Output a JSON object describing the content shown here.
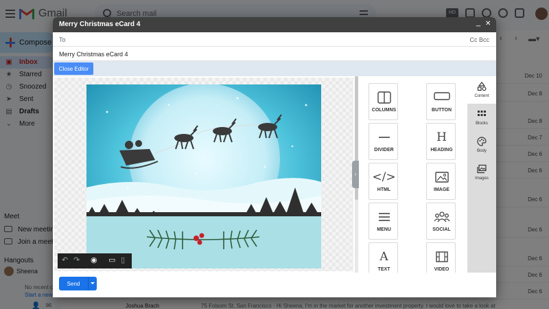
{
  "gmail": {
    "app_name": "Gmail",
    "search_placeholder": "Search mail",
    "compose_label": "Compose",
    "nav": [
      {
        "label": "Inbox",
        "icon": "inbox-icon",
        "active": true
      },
      {
        "label": "Starred",
        "icon": "star-icon"
      },
      {
        "label": "Snoozed",
        "icon": "clock-icon"
      },
      {
        "label": "Sent",
        "icon": "send-icon"
      },
      {
        "label": "Drafts",
        "icon": "draft-icon",
        "bold": true
      },
      {
        "label": "More",
        "icon": "chevron-down-icon"
      }
    ],
    "meet_label": "Meet",
    "meet_items": [
      "New meeting",
      "Join a meeting"
    ],
    "hangouts_label": "Hangouts",
    "hangouts_user": "Sheena",
    "no_recent": "No recent ch",
    "start_new": "Start a new",
    "list_dates": [
      "Dec 10",
      "Dec 8",
      "Dec 8",
      "Dec 7",
      "Dec 6",
      "Dec 6",
      "Dec 6",
      "Dec 6",
      "Dec 6",
      "Dec 6",
      "Dec 6",
      "Dec 6",
      "Dec 6"
    ],
    "last_row": {
      "sender": "Joshua Brach",
      "snippet": "75 Folsom St, San Francisco - Hi Sheena, I'm in the market for another investment property. I would love to take a look at"
    }
  },
  "dialog": {
    "title": "Merry Christmas eCard 4",
    "to_label": "To",
    "cc_bcc": "Cc Bcc",
    "subject": "Merry Christmas eCard 4",
    "close_editor": "Close Editor",
    "send_label": "Send"
  },
  "tools": [
    {
      "label": "COLUMNS",
      "icon": "columns-icon"
    },
    {
      "label": "BUTTON",
      "icon": "button-icon"
    },
    {
      "label": "DIVIDER",
      "icon": "divider-icon"
    },
    {
      "label": "HEADING",
      "icon": "heading-icon",
      "glyph": "H"
    },
    {
      "label": "HTML",
      "icon": "code-icon",
      "glyph": "</>"
    },
    {
      "label": "IMAGE",
      "icon": "image-icon"
    },
    {
      "label": "MENU",
      "icon": "menu-icon"
    },
    {
      "label": "SOCIAL",
      "icon": "social-icon"
    },
    {
      "label": "TEXT",
      "icon": "text-icon",
      "glyph": "A"
    },
    {
      "label": "VIDEO",
      "icon": "video-icon"
    }
  ],
  "right_tabs": [
    {
      "label": "Content",
      "icon": "shapes-icon",
      "active": true
    },
    {
      "label": "Blocks",
      "icon": "grid-icon"
    },
    {
      "label": "Body",
      "icon": "palette-icon"
    },
    {
      "label": "Images",
      "icon": "images-icon"
    }
  ],
  "colors": {
    "header": "#404040",
    "accent_blue": "#1a73e8",
    "close_editor_blue": "#4a8df6",
    "editor_bar": "#dfe7f1",
    "right_tabs_bg": "#dcdcdc",
    "card_sky": "#3cb4cf",
    "card_moon": "#d2f2fa",
    "card_ground": "#aadfe6"
  }
}
